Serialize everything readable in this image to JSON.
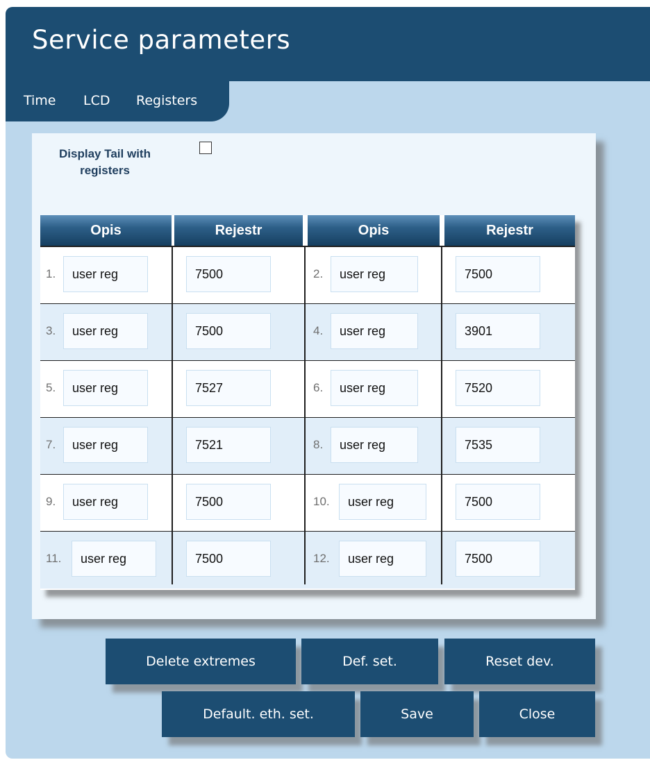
{
  "dialog": {
    "title": "Service parameters",
    "tabs": [
      {
        "label": "Time"
      },
      {
        "label": "LCD"
      },
      {
        "label": "Registers"
      }
    ]
  },
  "panel": {
    "tail_label": "Display Tail with registers",
    "tail_checked": false
  },
  "table": {
    "headers": [
      "Opis",
      "Rejestr",
      "Opis",
      "Rejestr"
    ],
    "rows": [
      {
        "left": {
          "num": "1.",
          "desc": "user reg",
          "reg": "7500"
        },
        "right": {
          "num": "2.",
          "desc": "user reg",
          "reg": "7500"
        }
      },
      {
        "left": {
          "num": "3.",
          "desc": "user reg",
          "reg": "7500"
        },
        "right": {
          "num": "4.",
          "desc": "user reg",
          "reg": "3901"
        }
      },
      {
        "left": {
          "num": "5.",
          "desc": "user reg",
          "reg": "7527"
        },
        "right": {
          "num": "6.",
          "desc": "user reg",
          "reg": "7520"
        }
      },
      {
        "left": {
          "num": "7.",
          "desc": "user reg",
          "reg": "7521"
        },
        "right": {
          "num": "8.",
          "desc": "user reg",
          "reg": "7535"
        }
      },
      {
        "left": {
          "num": "9.",
          "desc": "user reg",
          "reg": "7500"
        },
        "right": {
          "num": "10.",
          "desc": "user reg",
          "reg": "7500"
        }
      },
      {
        "left": {
          "num": "11.",
          "desc": "user reg",
          "reg": "7500"
        },
        "right": {
          "num": "12.",
          "desc": "user reg",
          "reg": "7500"
        }
      }
    ]
  },
  "buttons": {
    "delete_extremes": "Delete extremes",
    "def_set": "Def. set.",
    "reset_dev": "Reset dev.",
    "default_eth_set": "Default. eth. set.",
    "save": "Save",
    "close": "Close"
  },
  "colors": {
    "header": "#1c4d72",
    "dialog_bg": "#bcd7ec",
    "panel_bg": "#eef6fc",
    "row_alt": "#e1eef9"
  }
}
